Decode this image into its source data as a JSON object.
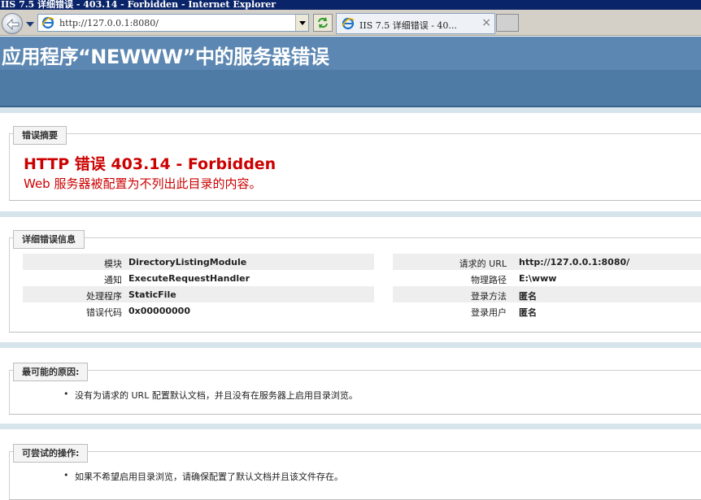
{
  "window": {
    "title": "IIS 7.5 详细错误 - 403.14 - Forbidden - Internet Explorer"
  },
  "nav": {
    "address": "http://127.0.0.1:8080/",
    "tab_label": "IIS 7.5 详细错误 - 40..."
  },
  "header": {
    "title": "应用程序“NEWWW”中的服务器错误"
  },
  "summary": {
    "legend": "错误摘要",
    "error_title": "HTTP 错误 403.14 - Forbidden",
    "error_description": "Web 服务器被配置为不列出此目录的内容。"
  },
  "details": {
    "legend": "详细错误信息",
    "left": [
      {
        "label": "模块",
        "value": "DirectoryListingModule"
      },
      {
        "label": "通知",
        "value": "ExecuteRequestHandler"
      },
      {
        "label": "处理程序",
        "value": "StaticFile"
      },
      {
        "label": "错误代码",
        "value": "0x00000000"
      }
    ],
    "right": [
      {
        "label": "请求的 URL",
        "value": "http://127.0.0.1:8080/"
      },
      {
        "label": "物理路径",
        "value": "E:\\www"
      },
      {
        "label": "登录方法",
        "value": "匿名"
      },
      {
        "label": "登录用户",
        "value": "匿名"
      }
    ]
  },
  "causes": {
    "legend": "最可能的原因:",
    "items": [
      "没有为请求的 URL 配置默认文档，并且没有在服务器上启用目录浏览。"
    ]
  },
  "actions": {
    "legend": "可尝试的操作:",
    "items": [
      "如果不希望启用目录浏览，请确保配置了默认文档并且该文件存在。"
    ]
  },
  "colors": {
    "titlebar": "#0a246a",
    "header": "#5c87b2",
    "error_red": "#cc0000"
  }
}
